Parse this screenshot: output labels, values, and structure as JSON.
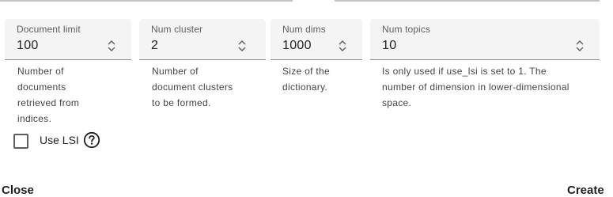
{
  "fields": [
    {
      "label": "Document limit",
      "value": "100",
      "helper": [
        "Number of",
        "documents",
        "retrieved from",
        "indices."
      ]
    },
    {
      "label": "Num cluster",
      "value": "2",
      "helper": [
        "Number of",
        "document clusters",
        "to be formed."
      ]
    },
    {
      "label": "Num dims",
      "value": "1000",
      "helper": [
        "Size of the",
        "dictionary."
      ]
    },
    {
      "label": "Num topics",
      "value": "10",
      "helper": [
        "Is only used if use_lsi is set to 1. The",
        "number of dimension in lower-dimensional",
        "space."
      ]
    }
  ],
  "use_lsi": {
    "label": "Use LSI",
    "checked": false
  },
  "footer": {
    "close_label": "Close",
    "create_label": "Create"
  }
}
